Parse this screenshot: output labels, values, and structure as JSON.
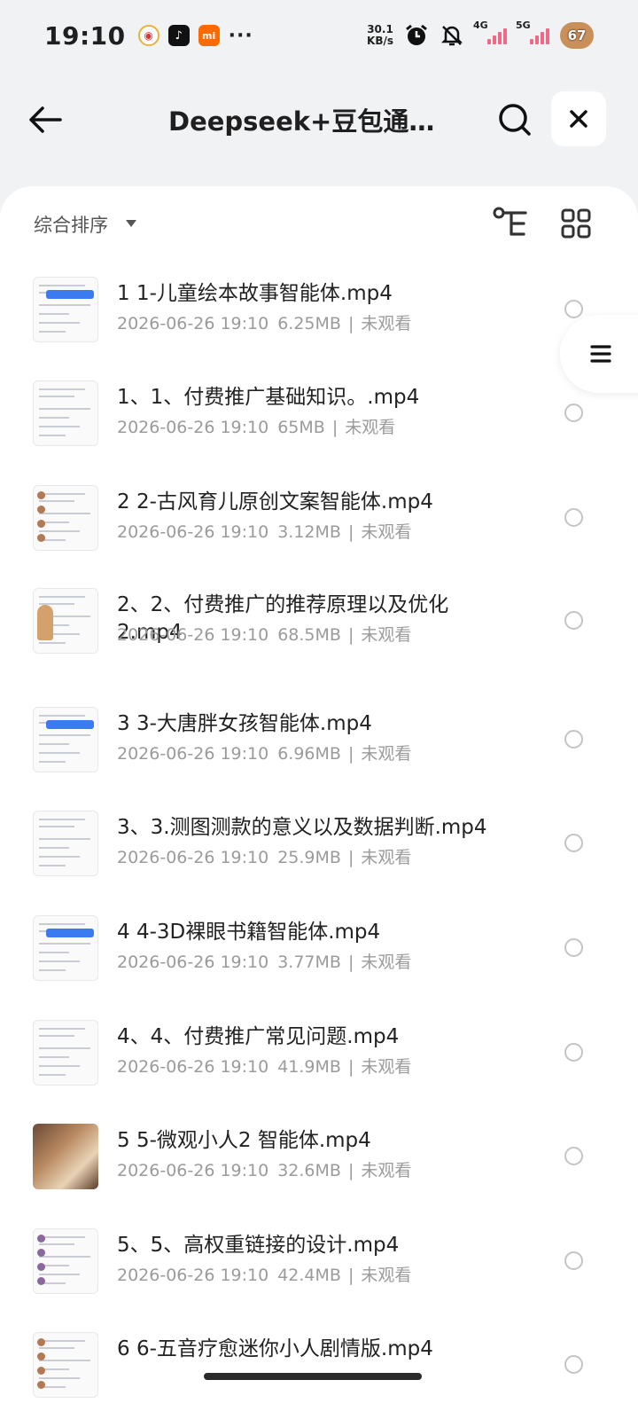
{
  "status": {
    "time": "19:10",
    "dots": "···",
    "net_speed_value": "30.1",
    "net_speed_unit": "KB/s",
    "sig1_label": "4G",
    "sig2_label": "5G",
    "battery": "67",
    "icons": [
      "weibo-icon",
      "tiktok-icon",
      "mi-icon",
      "alarm-icon",
      "mute-icon"
    ]
  },
  "header": {
    "title": "Deepseek+豆包通用智能体"
  },
  "toolbar": {
    "sort_label": "综合排序"
  },
  "files": [
    {
      "name": "1 1-儿童绘本故事智能体.mp4",
      "date": "2026-06-26 19:10",
      "size": "6.25MB",
      "status": "未观看"
    },
    {
      "name": "1、1、付费推广基础知识。.mp4",
      "date": "2026-06-26 19:10",
      "size": "65MB",
      "status": "未观看"
    },
    {
      "name": "2 2-古风育儿原创文案智能体.mp4",
      "date": "2026-06-26 19:10",
      "size": "3.12MB",
      "status": "未观看"
    },
    {
      "name": "2、2、付费推广的推荐原理以及优化2.mp4",
      "date": "2026-06-26 19:10",
      "size": "68.5MB",
      "status": "未观看"
    },
    {
      "name": "3 3-大唐胖女孩智能体.mp4",
      "date": "2026-06-26 19:10",
      "size": "6.96MB",
      "status": "未观看"
    },
    {
      "name": "3、3.测图测款的意义以及数据判断.mp4",
      "date": "2026-06-26 19:10",
      "size": "25.9MB",
      "status": "未观看"
    },
    {
      "name": "4 4-3D裸眼书籍智能体.mp4",
      "date": "2026-06-26 19:10",
      "size": "3.77MB",
      "status": "未观看"
    },
    {
      "name": "4、4、付费推广常见问题.mp4",
      "date": "2026-06-26 19:10",
      "size": "41.9MB",
      "status": "未观看"
    },
    {
      "name": "5 5-微观小人2 智能体.mp4",
      "date": "2026-06-26 19:10",
      "size": "32.6MB",
      "status": "未观看"
    },
    {
      "name": "5、5、高权重链接的设计.mp4",
      "date": "2026-06-26 19:10",
      "size": "42.4MB",
      "status": "未观看"
    },
    {
      "name": "6 6-五音疗愈迷你小人剧情版.mp4",
      "date": "",
      "size": "",
      "status": ""
    }
  ],
  "meta_separator": "|",
  "colors": {
    "background": "#f1f2f4",
    "panel": "#ffffff",
    "meta_text": "#9b9b9b"
  }
}
